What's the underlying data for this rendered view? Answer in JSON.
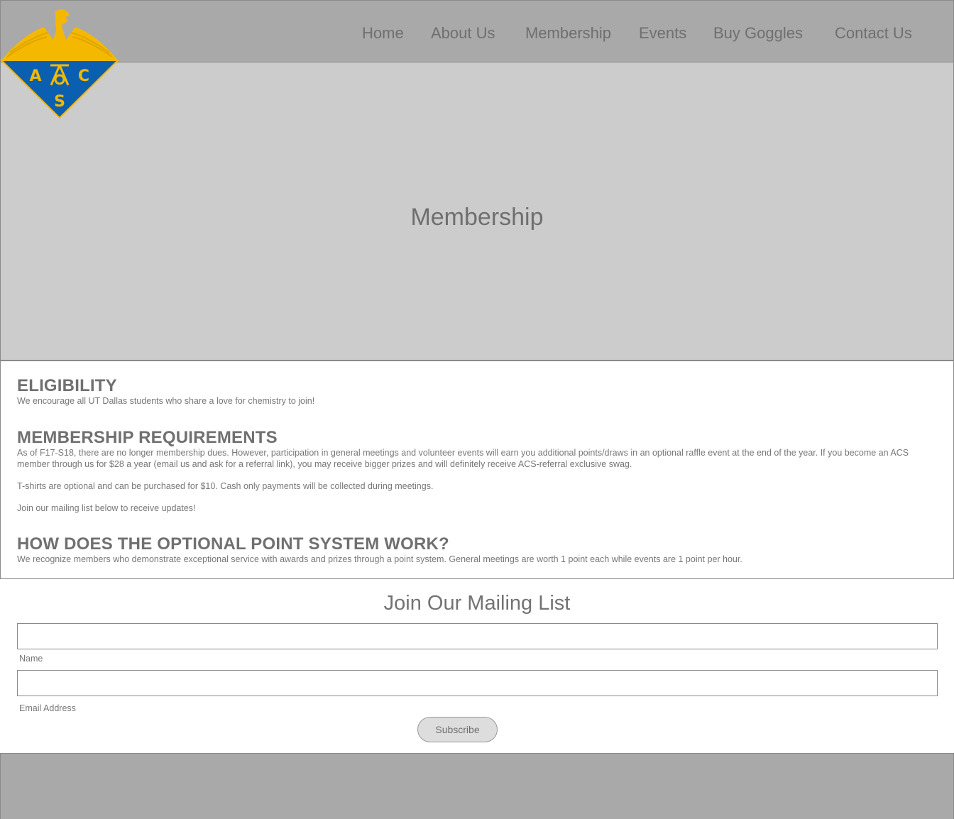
{
  "logo": {
    "letters": [
      "A",
      "C",
      "S"
    ],
    "icon": "acs-eagle-logo",
    "colors": {
      "gold": "#f5b800",
      "blue": "#0b5fb0"
    }
  },
  "nav": {
    "items": [
      {
        "label": "Home"
      },
      {
        "label": "About Us"
      },
      {
        "label": "Membership"
      },
      {
        "label": "Events"
      },
      {
        "label": "Buy Goggles"
      },
      {
        "label": "Contact Us"
      }
    ]
  },
  "hero": {
    "title": "Membership"
  },
  "sections": {
    "eligibility": {
      "heading": "ELIGIBILITY",
      "body": "We encourage all UT Dallas students who share a love for chemistry to join!"
    },
    "requirements": {
      "heading": "MEMBERSHIP REQUIREMENTS",
      "body1": "As of F17-S18, there are no longer membership dues. However, participation in general meetings and volunteer events will earn you additional points/draws in an optional raffle event at the end of the year. If you become an ACS member through us for $28 a year (email us and ask for a referral link), you may receive bigger prizes and will definitely receive ACS-referral exclusive swag.",
      "body2": "T-shirts are optional and can be purchased for $10. Cash only payments will be collected during meetings.",
      "body3": "Join our mailing list below to receive updates!"
    },
    "points": {
      "heading": "HOW DOES THE OPTIONAL POINT SYSTEM WORK?",
      "body": "We recognize members who demonstrate exceptional service with awards and prizes through a point system. General meetings are worth 1 point each while events are 1 point per hour."
    }
  },
  "mailing": {
    "title": "Join Our Mailing List",
    "name_label": "Name",
    "name_value": "",
    "email_label": "Email Address",
    "email_value": "",
    "subscribe_label": "Subscribe"
  }
}
